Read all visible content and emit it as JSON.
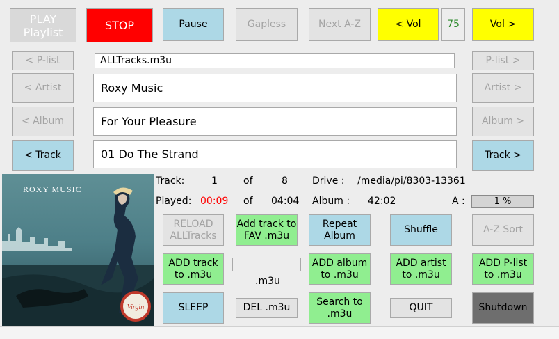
{
  "controls": {
    "play": "PLAY\nPlaylist",
    "stop": "STOP",
    "pause": "Pause",
    "gapless": "Gapless",
    "next_az": "Next A-Z",
    "vol_down": "< Vol",
    "volume": "75",
    "vol_up": "Vol >"
  },
  "nav": {
    "prev_plist": "< P-list",
    "next_plist": "P-list >",
    "prev_artist": "< Artist",
    "next_artist": "Artist >",
    "prev_album": "< Album",
    "next_album": "Album >",
    "prev_track": "< Track",
    "next_track": "Track >"
  },
  "fields": {
    "playlist": "ALLTracks.m3u",
    "artist": "Roxy Music",
    "album": "For Your Pleasure",
    "track": "01 Do The Strand"
  },
  "info": {
    "track_label": "Track:",
    "track_num": "1",
    "of1": "of",
    "track_total": "8",
    "drive_label": "Drive :",
    "drive_path": "/media/pi/8303-13361",
    "played_label": "Played:",
    "played_time": "00:09",
    "of2": "of",
    "track_length": "04:04",
    "album_label": "Album :",
    "album_length": "42:02",
    "a_label": "A :",
    "progress_text": "1 %"
  },
  "actions": {
    "reload": "RELOAD\nALLTracks",
    "add_fav": "Add track to\nFAV .m3u",
    "repeat_album": "Repeat\nAlbum",
    "shuffle": "Shuffle",
    "az_sort": "A-Z Sort",
    "add_track": "ADD track\nto .m3u",
    "m3u_input": "",
    "m3u_suffix": ".m3u",
    "add_album": "ADD album\nto .m3u",
    "add_artist": "ADD artist\nto .m3u",
    "add_plist": "ADD P-list\nto .m3u",
    "sleep": "SLEEP",
    "del_m3u": "DEL .m3u",
    "search": "Search to\n.m3u",
    "quit": "QUIT",
    "shutdown": "Shutdown"
  },
  "cover_art": {
    "band_text": "ROXY MUSIC",
    "badge_text": "Virgin"
  },
  "colors": {
    "red": "#ff0000",
    "blue": "#add8e6",
    "green": "#90ee90",
    "yellow": "#ffff00",
    "volume_text": "#2e8b2e",
    "played_time": "#ff0000"
  },
  "background_window": {
    "text_left": "...",
    "text_right": "..."
  }
}
